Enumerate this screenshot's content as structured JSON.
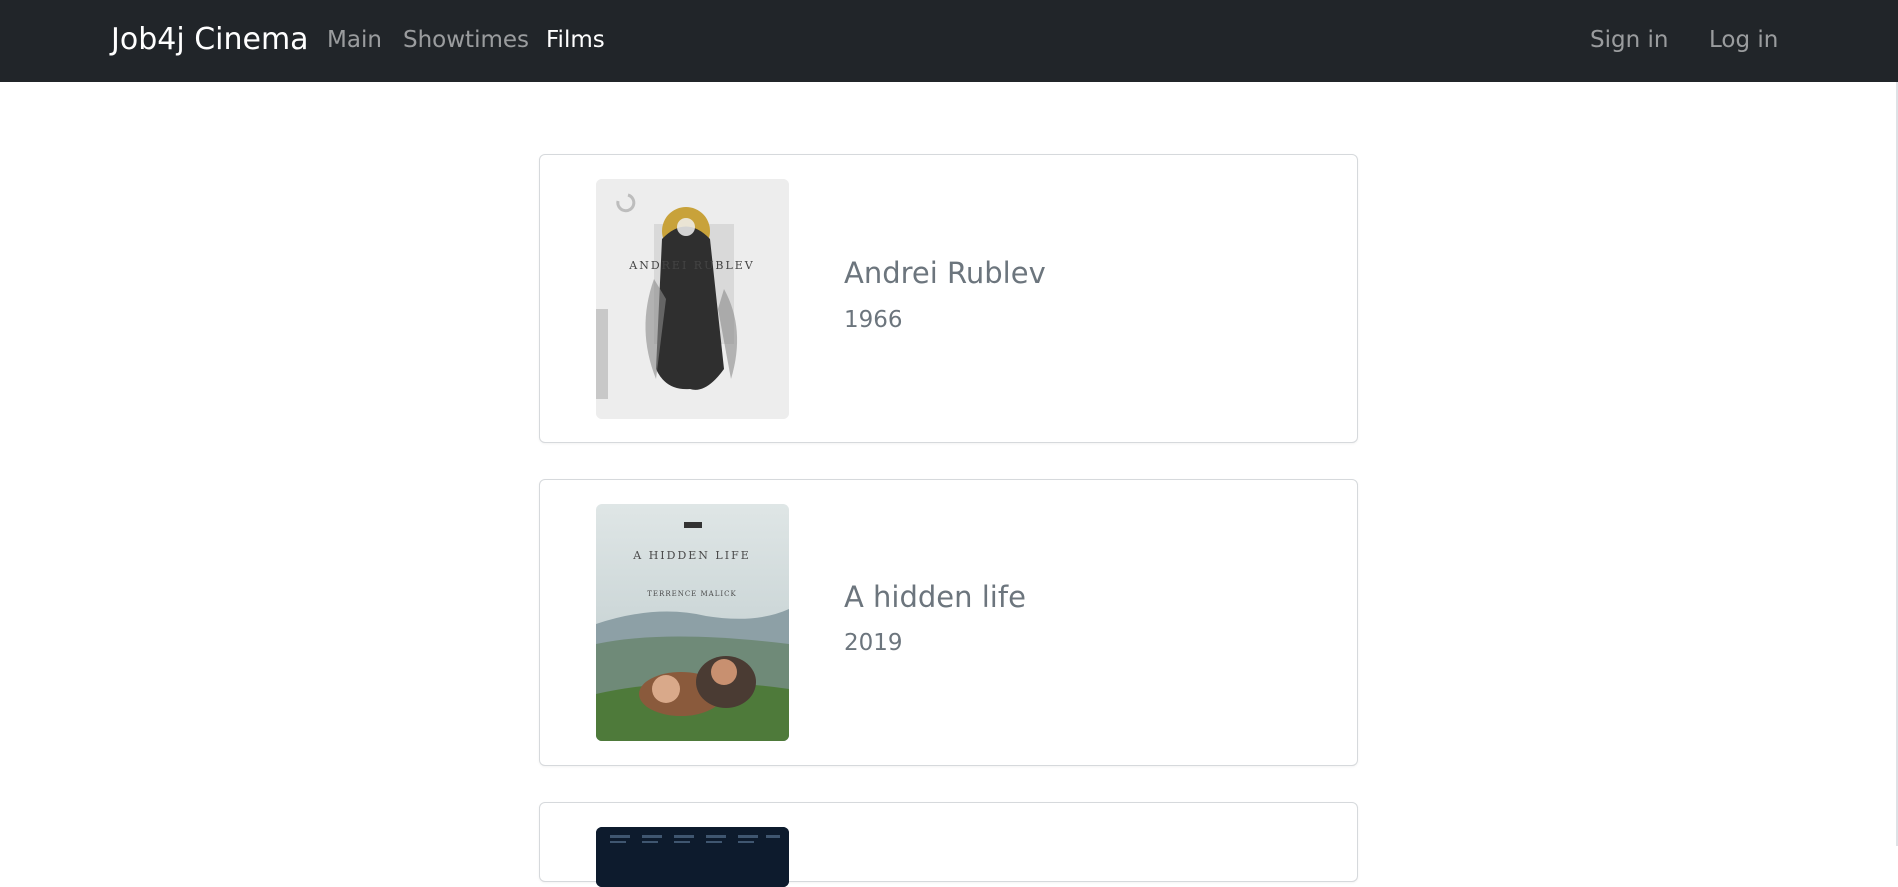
{
  "navbar": {
    "brand": "Job4j Cinema",
    "links": [
      {
        "label": "Main",
        "active": false
      },
      {
        "label": "Showtimes",
        "active": false
      },
      {
        "label": "Films",
        "active": true
      }
    ],
    "auth": {
      "sign_in": "Sign in",
      "log_in": "Log in"
    }
  },
  "films": [
    {
      "title": "Andrei Rublev",
      "year": "1966",
      "poster": {
        "label": "ANDREI RUBLEV",
        "icon": "poster-image"
      }
    },
    {
      "title": "A hidden life",
      "year": "2019",
      "poster": {
        "label": "A HIDDEN LIFE",
        "subtitle": "TERRENCE MALICK",
        "icon": "poster-image"
      }
    },
    {
      "title": "",
      "year": "",
      "poster": {
        "icon": "poster-image"
      }
    }
  ],
  "colors": {
    "navbar_bg": "#212529",
    "nav_text_muted": "rgba(255,255,255,0.55)",
    "nav_text_active": "#ffffff",
    "card_text": "#6c757d",
    "card_border": "#d6d9dc"
  }
}
